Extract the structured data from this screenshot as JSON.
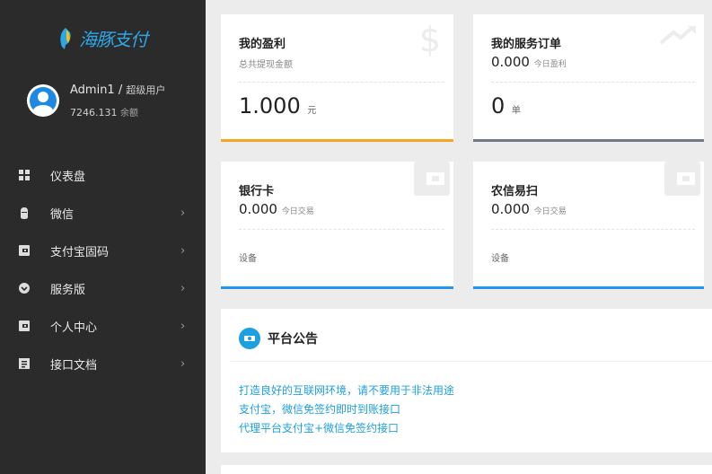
{
  "brand": {
    "name": "海豚支付",
    "color": "#2ea7e8"
  },
  "user": {
    "name": "Admin1",
    "separator": "/",
    "role": "超级用户",
    "balance": "7246.131",
    "balance_unit": "余额"
  },
  "nav": [
    {
      "label": "仪表盘",
      "icon": "dashboard-icon",
      "has_arrow": false
    },
    {
      "label": "微信",
      "icon": "wechat-icon",
      "has_arrow": true,
      "arrow": "›"
    },
    {
      "label": "支付宝固码",
      "icon": "wallet-icon",
      "has_arrow": true,
      "arrow": "›"
    },
    {
      "label": "服务版",
      "icon": "service-icon",
      "has_arrow": true,
      "arrow": "›"
    },
    {
      "label": "个人中心",
      "icon": "wallet-icon",
      "has_arrow": true,
      "arrow": "›"
    },
    {
      "label": "接口文档",
      "icon": "document-icon",
      "has_arrow": true,
      "arrow": "›"
    }
  ],
  "cards": {
    "profit": {
      "title": "我的盈利",
      "subtitle": "总共提现金额",
      "value": "1.000",
      "unit": "元",
      "accent": "#f5a623",
      "watermark": "$"
    },
    "orders": {
      "title": "我的服务订单",
      "stat_value": "0.000",
      "stat_label": "今日盈利",
      "value": "0",
      "unit": "单",
      "accent": "#6f7b8a",
      "watermark": "trend-icon"
    },
    "bank": {
      "title": "银行卡",
      "stat_value": "0.000",
      "stat_label": "今日交易",
      "device": "设备",
      "accent": "#2196f3",
      "watermark": "wallet-icon"
    },
    "nongxin": {
      "title": "农信易扫",
      "stat_value": "0.000",
      "stat_label": "今日交易",
      "device": "设备",
      "accent": "#2196f3",
      "watermark": "wallet-icon"
    }
  },
  "notice": {
    "title": "平台公告",
    "lines": [
      "打造良好的互联网环境，请不要用于非法用途",
      "支付宝，微信免签约即时到账接口",
      "代理平台支付宝+微信免签约接口"
    ],
    "color": "#1e9fe0"
  }
}
